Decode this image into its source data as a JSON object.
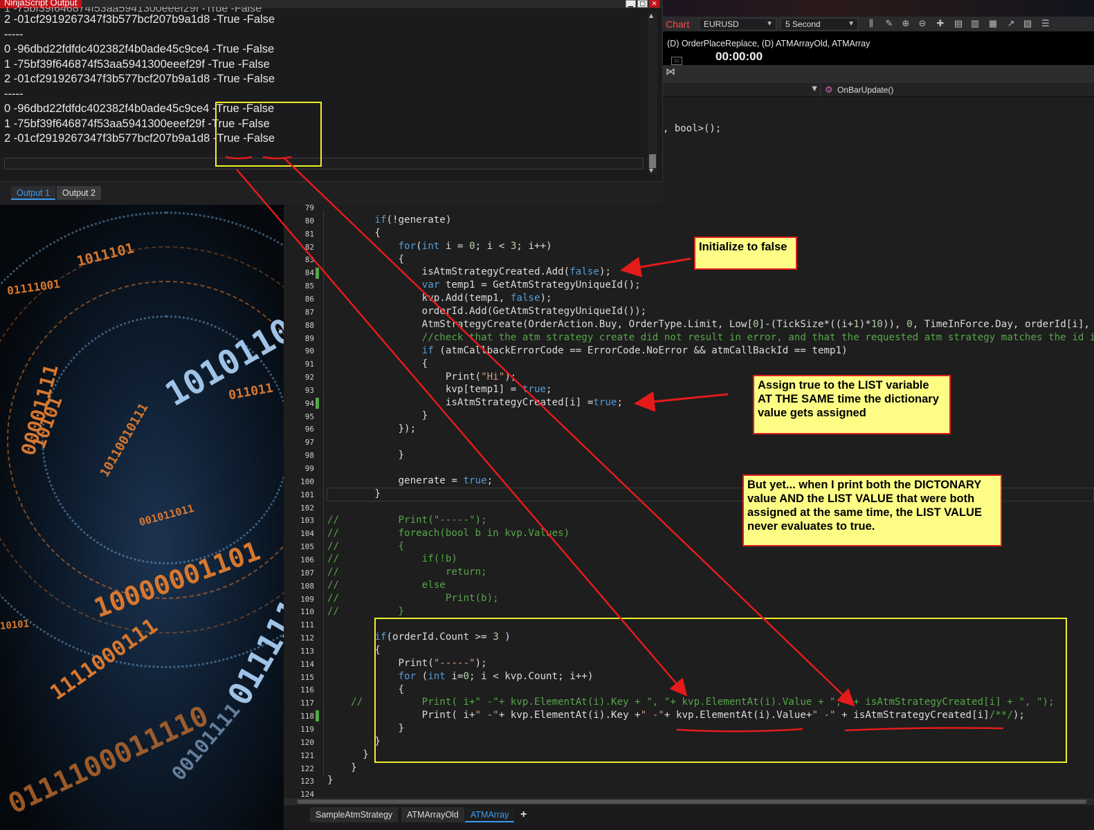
{
  "output_window": {
    "title": "NinjaScript Output",
    "lines_partial": "1 -75bf39f646874f53aa5941300eeef29f -True -False",
    "lines": [
      "2 -01cf2919267347f3b577bcf207b9a1d8 -True -False",
      "-----",
      "0 -96dbd22fdfdc402382f4b0ade45c9ce4 -True -False",
      "1 -75bf39f646874f53aa5941300eeef29f -True -False",
      "2 -01cf2919267347f3b577bcf207b9a1d8 -True -False",
      "-----",
      "0 -96dbd22fdfdc402382f4b0ade45c9ce4 -True -False",
      "1 -75bf39f646874f53aa5941300eeef29f -True -False",
      "2 -01cf2919267347f3b577bcf207b9a1d8 -True -False"
    ],
    "tabs": [
      "Output 1",
      "Output 2"
    ],
    "active_tab": "Output 1"
  },
  "chart": {
    "tab_label": "Chart",
    "instrument": "EURUSD",
    "interval": "5 Second",
    "series_label": "(D) OrderPlaceReplace, (D) ATMArrayOld, ATMArray",
    "timer": "00:00:00",
    "colors": {
      "tab": "#ff4a4a",
      "background": "#000000"
    }
  },
  "editor": {
    "member_dropdown": "OnBarUpdate()",
    "top_code": ", bool>();",
    "line_numbers": [
      "79",
      "80",
      "81",
      "82",
      "83",
      "84",
      "85",
      "86",
      "87",
      "88",
      "89",
      "90",
      "91",
      "92",
      "93",
      "94",
      "95",
      "96",
      "97",
      "98",
      "99",
      "100",
      "101",
      "102",
      "103",
      "104",
      "105",
      "106",
      "107",
      "108",
      "109",
      "110",
      "111",
      "112",
      "113",
      "114",
      "115",
      "116",
      "117",
      "118",
      "119",
      "120",
      "121",
      "122",
      "123",
      "124"
    ],
    "tabs": [
      "SampleAtmStrategy",
      "ATMArrayOld",
      "ATMArray"
    ],
    "active_tab": "ATMArray",
    "add_tab": "+",
    "colors": {
      "keyword": "#569cd6",
      "number": "#b5cea8",
      "string": "#d69d85",
      "comment": "#57a64a"
    }
  },
  "annotations": {
    "init_false": "Initialize to false",
    "assign_true": "Assign true to the LIST variable AT THE SAME time the dictionary value gets assigned",
    "but_yet": "But yet... when I print both the DICTONARY value AND the LIST VALUE that were both assigned at the same time, the LIST VALUE never evaluates to true."
  },
  "wallpaper": {
    "bits": [
      "1011101",
      "01111001",
      "1010110",
      "011011",
      "00001111",
      "10101",
      "10110010111",
      "001011011",
      "10000001101",
      "1111000111",
      "011111",
      "10101",
      "0111100011110",
      "00101111"
    ]
  }
}
